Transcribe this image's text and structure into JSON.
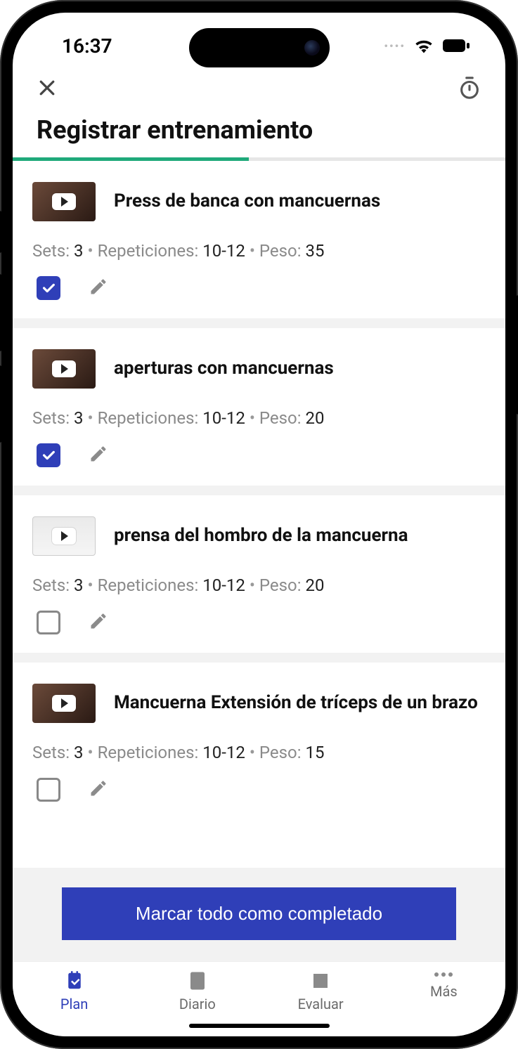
{
  "status": {
    "time": "16:37"
  },
  "header": {
    "title": "Registrar entrenamiento"
  },
  "progress": {
    "percent": 48
  },
  "labels": {
    "sets": "Sets",
    "reps": "Repeticiones",
    "weight": "Peso"
  },
  "exercises": [
    {
      "name": "Press de banca con mancuernas",
      "sets": "3",
      "reps": "10-12",
      "weight": "35",
      "done": true,
      "thumb": "dark"
    },
    {
      "name": "aperturas con mancuernas",
      "sets": "3",
      "reps": "10-12",
      "weight": "20",
      "done": true,
      "thumb": "dark"
    },
    {
      "name": "prensa del hombro de la mancuerna",
      "sets": "3",
      "reps": "10-12",
      "weight": "20",
      "done": false,
      "thumb": "light"
    },
    {
      "name": "Mancuerna Extensión de tríceps de un brazo",
      "sets": "3",
      "reps": "10-12",
      "weight": "15",
      "done": false,
      "thumb": "dark"
    }
  ],
  "footer": {
    "mark_all": "Marcar todo como completado"
  },
  "tabs": [
    {
      "id": "plan",
      "label": "Plan",
      "active": true
    },
    {
      "id": "diario",
      "label": "Diario",
      "active": false
    },
    {
      "id": "evaluar",
      "label": "Evaluar",
      "active": false
    },
    {
      "id": "mas",
      "label": "Más",
      "active": false
    }
  ]
}
